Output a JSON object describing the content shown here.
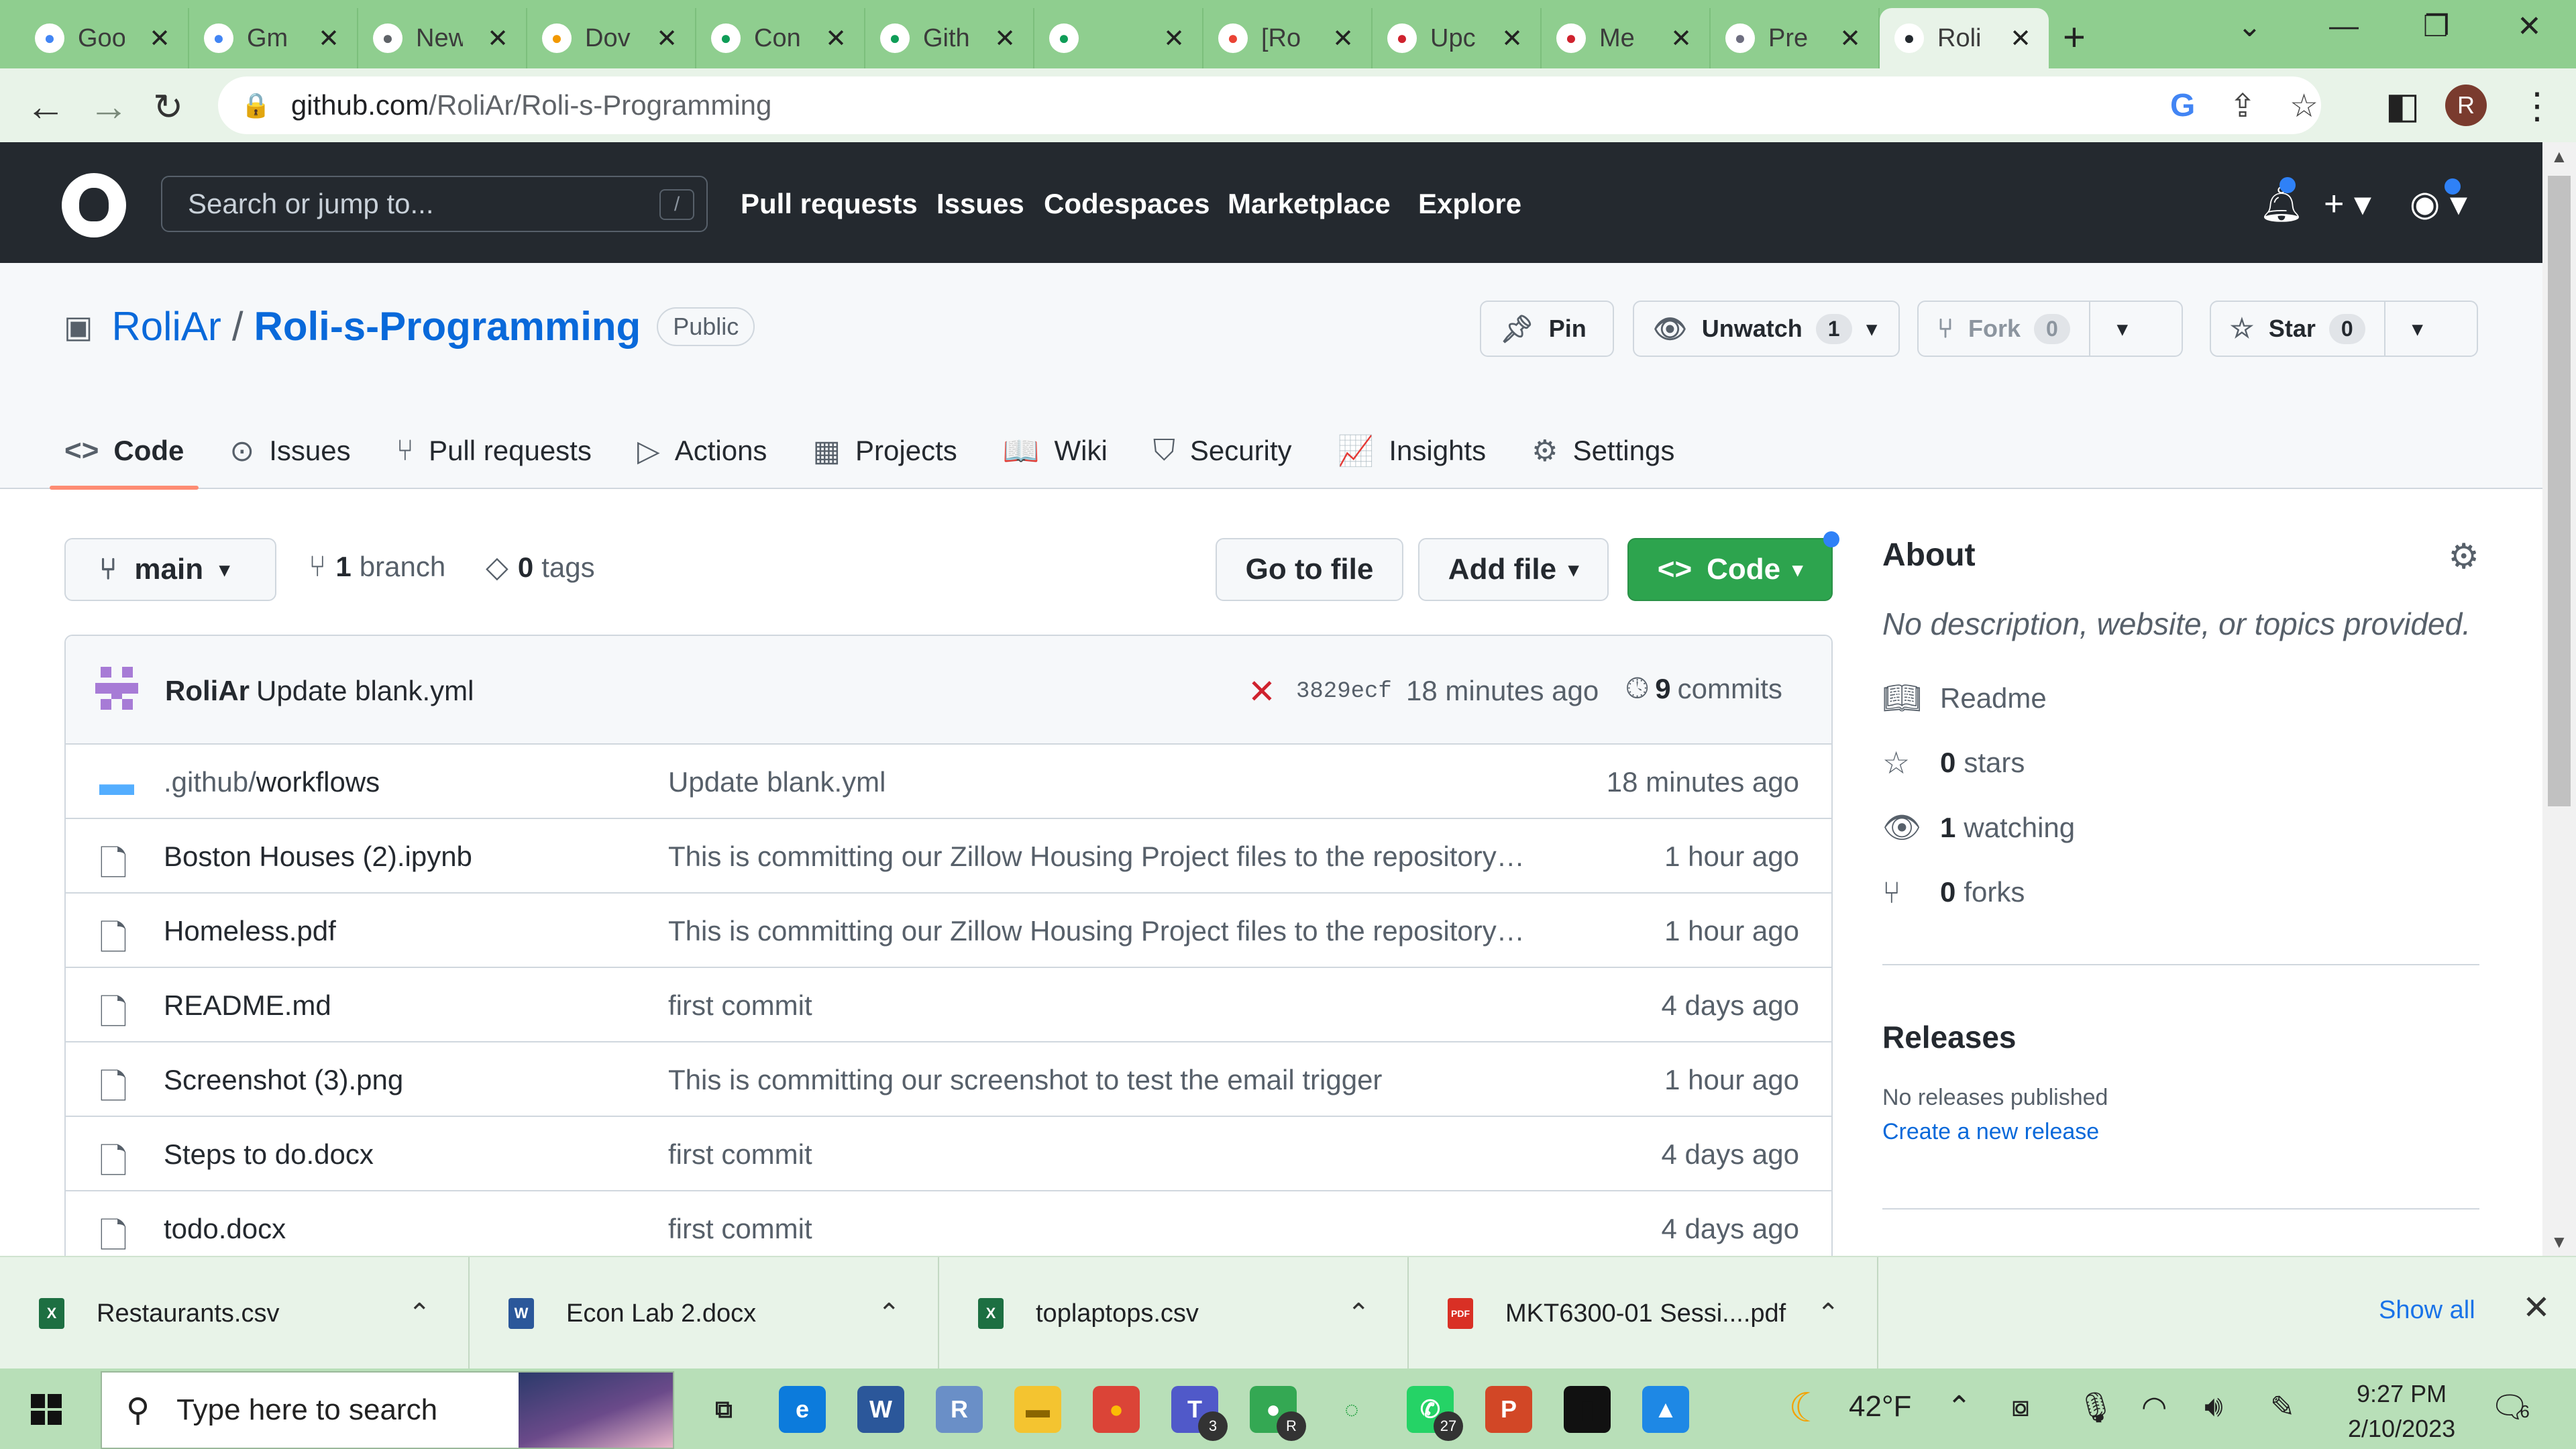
{
  "browser": {
    "tabs": [
      {
        "icon": "google-icon",
        "title": "Goo",
        "color": "#4285f4"
      },
      {
        "icon": "google-icon",
        "title": "Gm",
        "color": "#4285f4"
      },
      {
        "icon": "chrome-icon",
        "title": "New",
        "color": "#5f6368"
      },
      {
        "icon": "loading-icon",
        "title": "Dov",
        "color": "#f29900"
      },
      {
        "icon": "sheets-icon",
        "title": "Con",
        "color": "#0f9d58"
      },
      {
        "icon": "sheets-icon",
        "title": "Gith",
        "color": "#0f9d58"
      },
      {
        "icon": "sheets-icon",
        "title": "",
        "color": "#0f9d58"
      },
      {
        "icon": "gmail-icon",
        "title": "[Ro",
        "color": "#ea4335"
      },
      {
        "icon": "github-error-icon",
        "title": "Upc",
        "color": "#cf222e"
      },
      {
        "icon": "github-error-icon",
        "title": "Me",
        "color": "#cf222e"
      },
      {
        "icon": "openai-icon",
        "title": "Pre",
        "color": "#6e6e80"
      },
      {
        "icon": "github-icon",
        "title": "Roli",
        "color": "#24292f",
        "active": true
      }
    ],
    "url_host": "github.com",
    "url_path": "/RoliAr/Roli-s-Programming",
    "profile_initial": "R"
  },
  "github": {
    "search_placeholder": "Search or jump to...",
    "search_key": "/",
    "nav": [
      "Pull requests",
      "Issues",
      "Codespaces",
      "Marketplace",
      "Explore"
    ]
  },
  "repo": {
    "owner": "RoliAr",
    "separator": "/",
    "name": "Roli-s-Programming",
    "visibility": "Public",
    "pin_label": "Pin",
    "watch_label": "Unwatch",
    "watch_count": "1",
    "fork_label": "Fork",
    "fork_count": "0",
    "star_label": "Star",
    "star_count": "0",
    "tabs": [
      {
        "icon": "code-icon",
        "glyph": "<>",
        "label": "Code",
        "selected": true
      },
      {
        "icon": "issues-icon",
        "glyph": "⊙",
        "label": "Issues"
      },
      {
        "icon": "pull-request-icon",
        "glyph": "⑂",
        "label": "Pull requests"
      },
      {
        "icon": "actions-icon",
        "glyph": "▷",
        "label": "Actions"
      },
      {
        "icon": "projects-icon",
        "glyph": "▦",
        "label": "Projects"
      },
      {
        "icon": "wiki-icon",
        "glyph": "📖",
        "label": "Wiki"
      },
      {
        "icon": "security-icon",
        "glyph": "⛉",
        "label": "Security"
      },
      {
        "icon": "insights-icon",
        "glyph": "📈",
        "label": "Insights"
      },
      {
        "icon": "settings-icon",
        "glyph": "⚙",
        "label": "Settings"
      }
    ]
  },
  "code": {
    "branch": "main",
    "branch_count": "1",
    "branch_word": "branch",
    "tag_count": "0",
    "tag_word": "tags",
    "go_to_file": "Go to file",
    "add_file": "Add file",
    "code_button": "Code",
    "latest_commit": {
      "author": "RoliAr",
      "message": "Update blank.yml",
      "status": "✕",
      "sha": "3829ecf",
      "time": "18 minutes ago",
      "commit_count": "9",
      "commit_word": "commits"
    },
    "files": [
      {
        "type": "folder",
        "name_dim": ".github/",
        "name": "workflows",
        "message": "Update blank.yml",
        "age": "18 minutes ago"
      },
      {
        "type": "file",
        "name_dim": "",
        "name": "Boston Houses (2).ipynb",
        "message": "This is committing our Zillow Housing Project files to the repository…",
        "age": "1 hour ago"
      },
      {
        "type": "file",
        "name_dim": "",
        "name": "Homeless.pdf",
        "message": "This is committing our Zillow Housing Project files to the repository…",
        "age": "1 hour ago"
      },
      {
        "type": "file",
        "name_dim": "",
        "name": "README.md",
        "message": "first commit",
        "age": "4 days ago"
      },
      {
        "type": "file",
        "name_dim": "",
        "name": "Screenshot (3).png",
        "message": "This is committing our screenshot to test the email trigger",
        "age": "1 hour ago"
      },
      {
        "type": "file",
        "name_dim": "",
        "name": "Steps to do.docx",
        "message": "first commit",
        "age": "4 days ago"
      },
      {
        "type": "file",
        "name_dim": "",
        "name": "todo.docx",
        "message": "first commit",
        "age": "4 days ago"
      }
    ]
  },
  "about": {
    "title": "About",
    "description": "No description, website, or topics provided.",
    "readme": "Readme",
    "stars_count": "0",
    "stars_word": "stars",
    "watching_count": "1",
    "watching_word": "watching",
    "forks_count": "0",
    "forks_word": "forks",
    "releases_title": "Releases",
    "no_releases": "No releases published",
    "create_release": "Create a new release"
  },
  "downloads": {
    "items": [
      {
        "icon": "excel-file-icon",
        "name": "Restaurants.csv",
        "badge": "X",
        "color": "#1d6f42"
      },
      {
        "icon": "word-file-icon",
        "name": "Econ Lab 2.docx",
        "badge": "W",
        "color": "#2b579a"
      },
      {
        "icon": "excel-file-icon",
        "name": "toplaptops.csv",
        "badge": "X",
        "color": "#1d6f42"
      },
      {
        "icon": "pdf-file-icon",
        "name": "MKT6300-01 Sessi....pdf",
        "badge": "PDF",
        "color": "#d93025"
      }
    ],
    "show_all": "Show all"
  },
  "taskbar": {
    "search_placeholder": "Type here to search",
    "apps": [
      {
        "icon": "task-view-icon",
        "label": "⧉",
        "color": "#b8dfb8",
        "fg": "#222"
      },
      {
        "icon": "edge-icon",
        "label": "e",
        "color": "#0c7bdc",
        "fg": "#fff"
      },
      {
        "icon": "word-icon",
        "label": "W",
        "color": "#2b579a",
        "fg": "#fff"
      },
      {
        "icon": "r-icon",
        "label": "R",
        "color": "#6a8fc7",
        "fg": "#fff"
      },
      {
        "icon": "file-explorer-icon",
        "label": "▬",
        "color": "#f4c430",
        "fg": "#8a6500"
      },
      {
        "icon": "chrome-icon",
        "label": "●",
        "color": "#db4437",
        "fg": "#fbbc05"
      },
      {
        "icon": "teams-icon",
        "label": "T",
        "color": "#5059c9",
        "fg": "#fff",
        "badge": "3"
      },
      {
        "icon": "chrome-profile-icon",
        "label": "●",
        "color": "#34a853",
        "fg": "#fff",
        "badge": "R"
      },
      {
        "icon": "refresh-app-icon",
        "label": "◌",
        "color": "#b8dfb8",
        "fg": "#1a9e3a"
      },
      {
        "icon": "whatsapp-icon",
        "label": "✆",
        "color": "#25d366",
        "fg": "#fff",
        "badge": "27"
      },
      {
        "icon": "powerpoint-icon",
        "label": "P",
        "color": "#d24726",
        "fg": "#fff"
      },
      {
        "icon": "terminal-icon",
        "label": "▮",
        "color": "#111",
        "fg": "#111"
      },
      {
        "icon": "photos-icon",
        "label": "▲",
        "color": "#1e88e5",
        "fg": "#fff"
      }
    ],
    "weather": "42°F",
    "time": "9:27 PM",
    "date": "2/10/2023",
    "notifications": "6"
  }
}
